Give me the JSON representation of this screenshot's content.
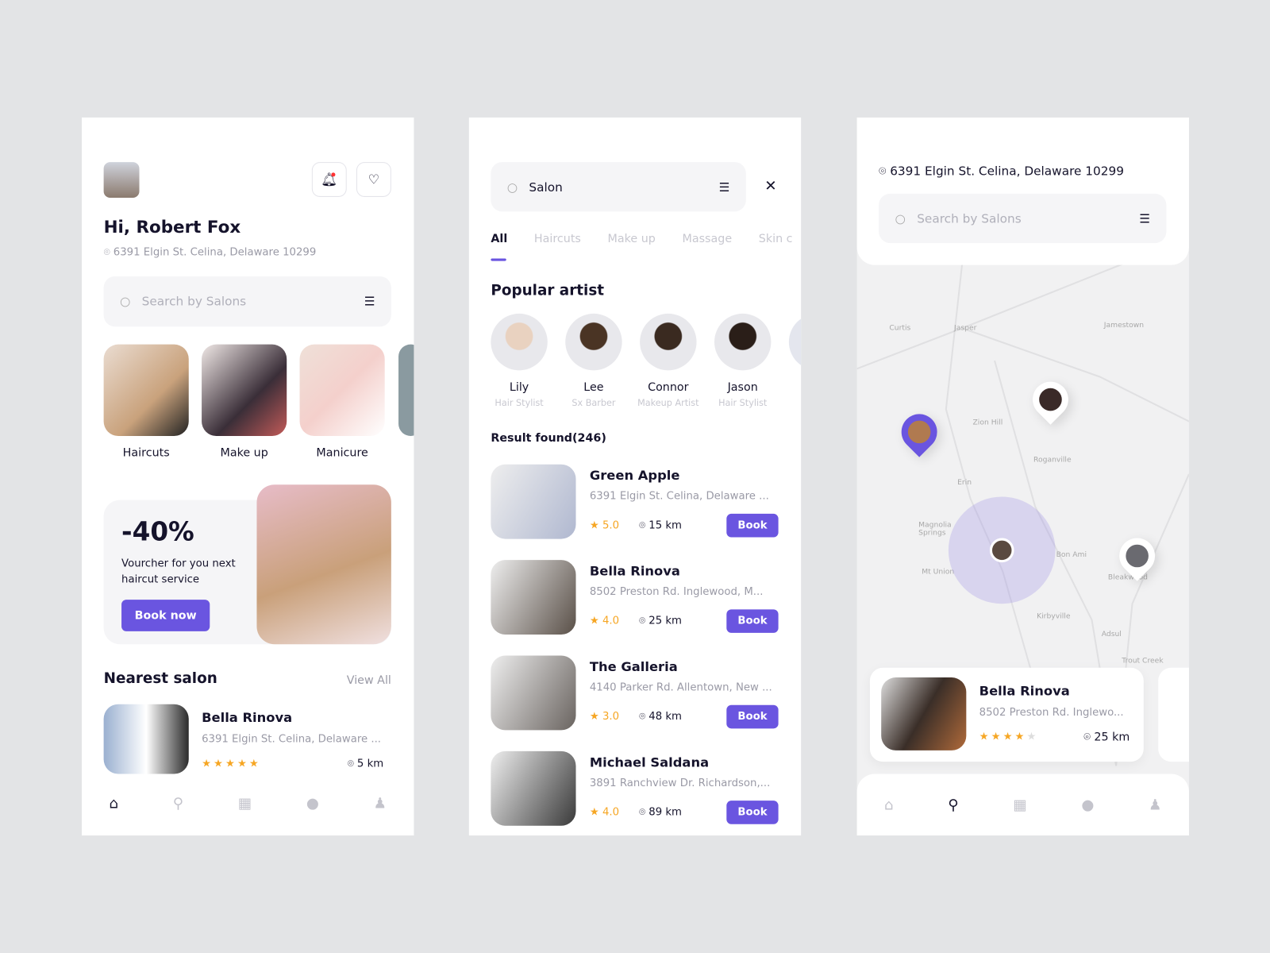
{
  "home": {
    "greeting": "Hi, Robert Fox",
    "address": "6391 Elgin St. Celina, Delaware 10299",
    "search_placeholder": "Search by Salons",
    "categories": [
      {
        "label": "Haircuts"
      },
      {
        "label": "Make up"
      },
      {
        "label": "Manicure"
      }
    ],
    "promo": {
      "discount": "-40%",
      "text": "Vourcher for you next haircut service",
      "button": "Book now"
    },
    "nearest": {
      "title": "Nearest salon",
      "view_all": "View All",
      "name": "Bella Rinova",
      "address": "6391 Elgin St. Celina, Delaware ...",
      "rating": 5,
      "distance": "5 km"
    }
  },
  "search": {
    "query": "Salon",
    "tabs": [
      "All",
      "Haircuts",
      "Make up",
      "Massage",
      "Skin c"
    ],
    "active_tab": "All",
    "popular_title": "Popular artist",
    "artists": [
      {
        "name": "Lily",
        "role": "Hair Stylist"
      },
      {
        "name": "Lee",
        "role": "Sx Barber"
      },
      {
        "name": "Connor",
        "role": "Makeup Artist"
      },
      {
        "name": "Jason",
        "role": "Hair Stylist"
      }
    ],
    "result_label": "Result found(246)",
    "results": [
      {
        "name": "Green Apple",
        "address": "6391 Elgin St. Celina, Delaware ...",
        "rating": "5.0",
        "distance": "15 km",
        "button": "Book"
      },
      {
        "name": "Bella Rinova",
        "address": "8502 Preston Rd. Inglewood, M...",
        "rating": "4.0",
        "distance": "25 km",
        "button": "Book"
      },
      {
        "name": "The Galleria",
        "address": "4140 Parker Rd. Allentown, New ...",
        "rating": "3.0",
        "distance": "48 km",
        "button": "Book"
      },
      {
        "name": "Michael Saldana",
        "address": "3891 Ranchview Dr. Richardson,...",
        "rating": "4.0",
        "distance": "89 km",
        "button": "Book"
      }
    ]
  },
  "map": {
    "address": "6391 Elgin St. Celina, Delaware 10299",
    "search_placeholder": "Search by Salons",
    "places": [
      "Curtis",
      "Jasper",
      "Jamestown",
      "Zion Hill",
      "Roganville",
      "Erin",
      "Magnolia Springs",
      "Bon Ami",
      "Mt Union",
      "Bleakwood",
      "Kirbyville",
      "Adsul",
      "Trout Creek"
    ],
    "card": {
      "name": "Bella Rinova",
      "address": "8502 Preston Rd. Inglewo...",
      "rating": 4,
      "distance": "25 km"
    }
  },
  "colors": {
    "accent": "#6a55e0",
    "star": "#f6a623",
    "background": "#e3e4e6"
  },
  "nav_icons": [
    "home-icon",
    "map-pin-icon",
    "calendar-icon",
    "chat-icon",
    "profile-icon"
  ]
}
